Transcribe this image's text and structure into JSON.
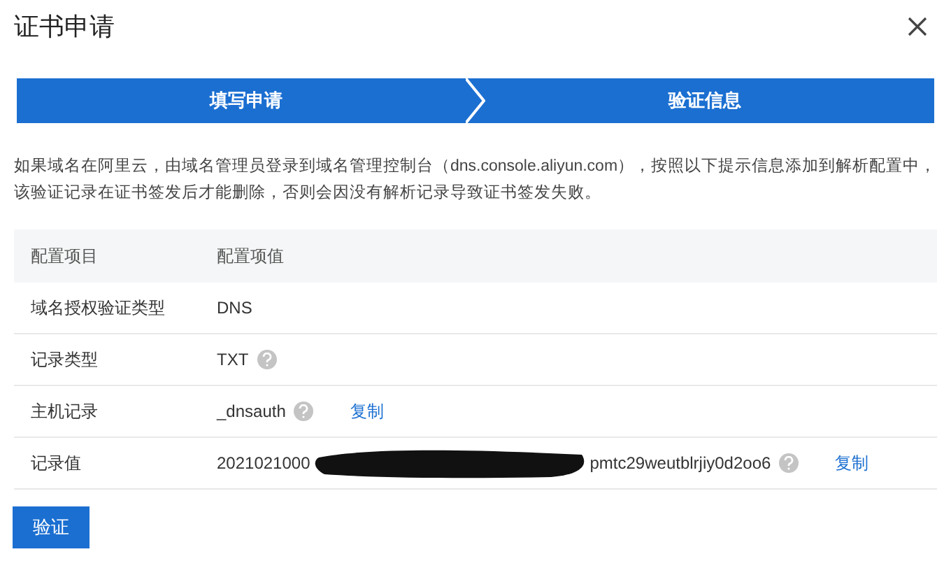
{
  "dialog": {
    "title": "证书申请"
  },
  "steps": [
    {
      "label": "填写申请"
    },
    {
      "label": "验证信息"
    }
  ],
  "description": "如果域名在阿里云，由域名管理员登录到域名管理控制台（dns.console.aliyun.com），按照以下提示信息添加到解析配置中，该验证记录在证书签发后才能删除，否则会因没有解析记录导致证书签发失败。",
  "table": {
    "columns": [
      "配置项目",
      "配置项值"
    ],
    "rows": [
      {
        "item": "域名授权验证类型",
        "value": "DNS",
        "help": false
      },
      {
        "item": "记录类型",
        "value": "TXT",
        "help": true
      },
      {
        "item": "主机记录",
        "value": "_dnsauth",
        "help": true,
        "copy": "复制"
      },
      {
        "item": "记录值",
        "value": "2021021000",
        "value_tail": "pmtc29weutblrjiy0d2oo6",
        "help": true,
        "copy": "复制"
      }
    ]
  },
  "button": "验证"
}
